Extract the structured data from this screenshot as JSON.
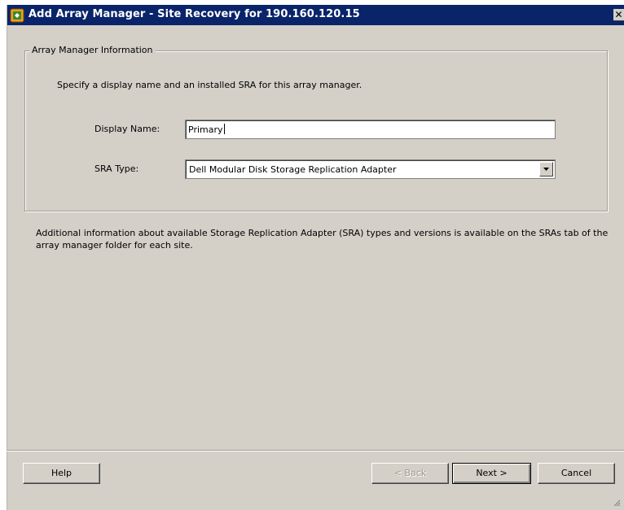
{
  "window": {
    "title": "Add Array Manager - Site Recovery for 190.160.120.15",
    "close_label": "✕"
  },
  "group": {
    "legend": "Array Manager Information",
    "instruction": "Specify a display name and an installed SRA for this array manager."
  },
  "form": {
    "display_name_label": "Display Name:",
    "display_name_value": "Primary",
    "sra_type_label": "SRA Type:",
    "sra_type_value": "Dell Modular Disk Storage Replication Adapter"
  },
  "info_text": "Additional information about available Storage Replication Adapter (SRA) types and versions is available on the SRAs tab of the array manager folder for each site.",
  "buttons": {
    "help_label": "Help",
    "back_label": "< Back",
    "next_label": "Next >",
    "cancel_label": "Cancel"
  },
  "colors": {
    "titlebar": "#0a246a",
    "dialog_bg": "#d4d0c8"
  }
}
